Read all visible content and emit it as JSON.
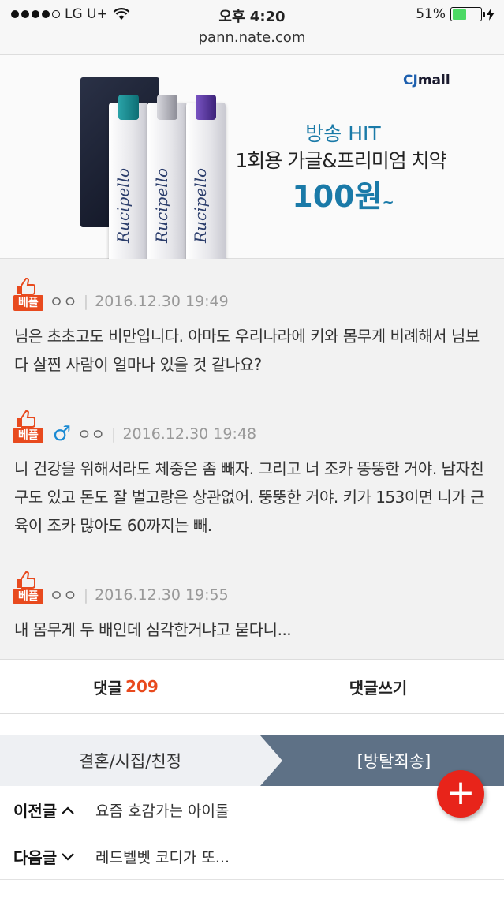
{
  "status_bar": {
    "carrier": "LG U+",
    "time": "오후 4:20",
    "battery_percent": "51%",
    "battery_level": 0.51
  },
  "url": "pann.nate.com",
  "ad": {
    "brand": "CJmall",
    "brand_prefix": "CJ",
    "brand_suffix": "mall",
    "line1": "방송 HIT",
    "line2": "1회용 가글&프리미엄 치약",
    "price": "100원",
    "price_suffix": "~",
    "product_script": "Rucipello"
  },
  "comments": [
    {
      "badge": "베플",
      "author": "ㅇㅇ",
      "timestamp": "2016.12.30 19:49",
      "text": "님은 초초고도 비만입니다. 아마도 우리나라에 키와 몸무게 비례해서 님보다 살찐 사람이 얼마나 있을 것 같나요?"
    },
    {
      "badge": "베플",
      "author": "ㅇㅇ",
      "gender_icon": "male-icon",
      "timestamp": "2016.12.30 19:48",
      "text": "니 건강을 위해서라도 체중은 좀 빼자. 그리고 너 조카 뚱뚱한 거야. 남자친구도 있고 돈도 잘 벌고랑은 상관없어. 뚱뚱한 거야. 키가 153이면 니가 근육이 조카 많아도 60까지는 빼."
    },
    {
      "badge": "베플",
      "author": "ㅇㅇ",
      "timestamp": "2016.12.30 19:55",
      "text": "내 몸무게 두 배인데 심각한거냐고 묻다니..."
    }
  ],
  "actions": {
    "comments_label": "댓글",
    "comments_count": "209",
    "write_label": "댓글쓰기"
  },
  "category": {
    "left": "결혼/시집/친정",
    "right": "[방탈죄송]"
  },
  "nav": {
    "prev_label": "이전글",
    "prev_title": "요즘 호감가는 아이돌",
    "next_label": "다음글",
    "next_title": "레드벨벳 코디가 또..."
  },
  "fab_label": "+",
  "colors": {
    "accent": "#e84a1e",
    "fab": "#e8241a",
    "category_active": "#5e7186",
    "ad_blue": "#1a7aa8"
  }
}
